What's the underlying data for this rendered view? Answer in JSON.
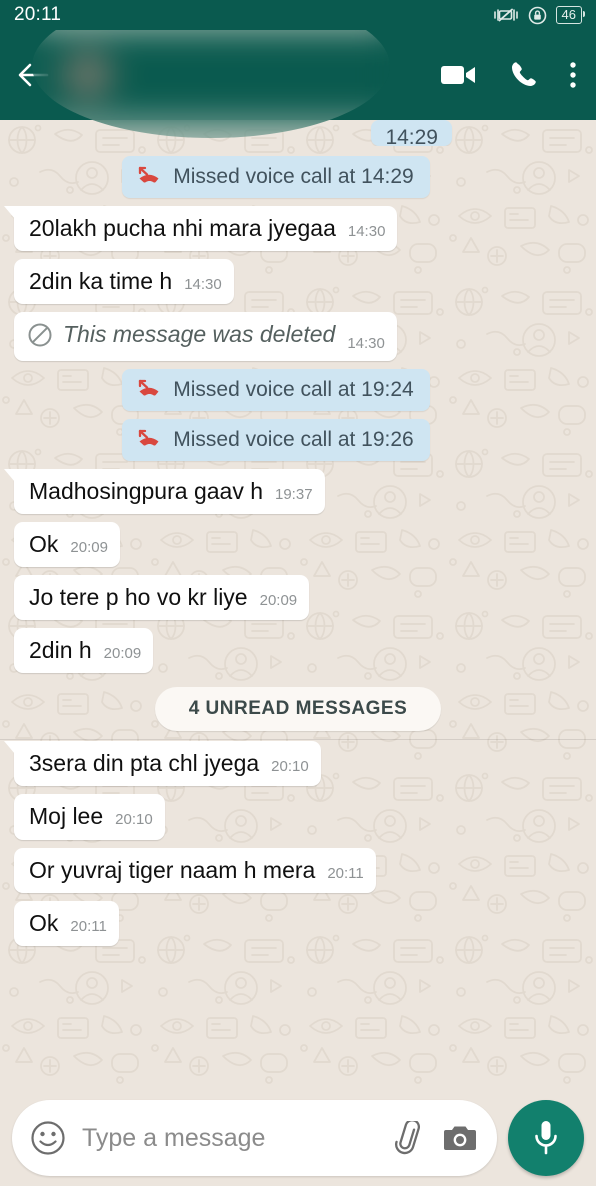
{
  "statusbar": {
    "time": "20:11",
    "battery_level": "46",
    "icons": [
      "vibrate-mute-icon",
      "lock-circle-icon",
      "battery-icon"
    ]
  },
  "header": {
    "back_icon": "back-arrow-icon",
    "contact_name": "",
    "contact_status": "",
    "privacy_blurred": "true",
    "actions": [
      {
        "name": "video-call-button",
        "icon": "video-camera-icon"
      },
      {
        "name": "voice-call-button",
        "icon": "phone-icon"
      },
      {
        "name": "overflow-menu-button",
        "icon": "three-dots-vertical-icon"
      }
    ]
  },
  "chat": {
    "clipped_top_bubble": {
      "time": "14:29"
    },
    "unread_divider": "4 UNREAD MESSAGES",
    "messages": [
      {
        "type": "call",
        "icon": "missed-call-icon",
        "text": "Missed voice call at 14:29"
      },
      {
        "type": "text",
        "text": "20lakh pucha nhi mara jyegaa",
        "time": "14:30",
        "tail": "true"
      },
      {
        "type": "text",
        "text": "2din ka time h",
        "time": "14:30",
        "tail": "false"
      },
      {
        "type": "deleted",
        "icon": "blocked-circle-icon",
        "text": "This message was deleted",
        "time": "14:30"
      },
      {
        "type": "call",
        "icon": "missed-call-icon",
        "text": "Missed voice call at 19:24"
      },
      {
        "type": "call",
        "icon": "missed-call-icon",
        "text": "Missed voice call at 19:26"
      },
      {
        "type": "text",
        "text": "Madhosingpura gaav h",
        "time": "19:37",
        "tail": "true"
      },
      {
        "type": "text",
        "text": "Ok",
        "time": "20:09",
        "tail": "false"
      },
      {
        "type": "text",
        "text": "Jo tere p ho vo kr liye",
        "time": "20:09",
        "tail": "false"
      },
      {
        "type": "text",
        "text": "2din h",
        "time": "20:09",
        "tail": "false"
      },
      {
        "type": "divider"
      },
      {
        "type": "text",
        "text": "3sera din pta chl jyega",
        "time": "20:10",
        "tail": "true"
      },
      {
        "type": "text",
        "text": "Moj lee",
        "time": "20:10",
        "tail": "false"
      },
      {
        "type": "text",
        "text": "Or yuvraj tiger naam h mera",
        "time": "20:11",
        "tail": "false"
      },
      {
        "type": "text",
        "text": "Ok",
        "time": "20:11",
        "tail": "false"
      }
    ]
  },
  "input": {
    "placeholder": "Type a message",
    "value": "",
    "emoji_icon": "emoji-smiley-icon",
    "attach_icon": "paperclip-icon",
    "camera_icon": "camera-icon",
    "mic_icon": "microphone-icon"
  },
  "colors": {
    "header_teal": "#0a5a4f",
    "chat_background": "#ece5dd",
    "outgoing_bubble": "#ffffff",
    "system_bubble": "#cfe5f2",
    "mic_button": "#12806d",
    "missed_call_red": "#d9483f",
    "timestamp_gray": "#8e9294"
  }
}
